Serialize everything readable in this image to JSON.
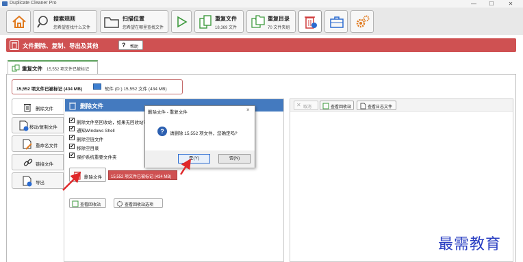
{
  "window": {
    "title": "Duplicate Cleaner Pro",
    "controls": [
      "—",
      "☐",
      "✕"
    ]
  },
  "toolbar": {
    "search_rules_title": "搜索规则",
    "search_rules_sub": "您希望查找什么文件",
    "scan_location_title": "扫描位置",
    "scan_location_sub": "您希望在哪里查找文件",
    "dup_files_title": "重复文件",
    "dup_files_sub": "18,369 文件",
    "dup_folders_title": "重复目录",
    "dup_folders_sub": "70 文件夹组"
  },
  "banner": {
    "title": "文件删除、复制、导出及其他",
    "help_label": "帮助"
  },
  "tab": {
    "title": "重复文件",
    "subtitle": "15,552 项文件已被标记"
  },
  "stats": {
    "marked": "15,552 项文件已被标记 (434 MB)",
    "location": "软件 (D:) 15,552 文件 (434 MB)"
  },
  "side_tabs": [
    {
      "label": "删除文件"
    },
    {
      "label": "移动/复制文件"
    },
    {
      "label": "重命名文件"
    },
    {
      "label": "链接文件"
    },
    {
      "label": "导出"
    }
  ],
  "delete_section": {
    "header": "删除文件",
    "options": [
      "删除文件至回收站，如果无回收站可",
      "通知Windows Shell",
      "删除空链文件",
      "移除空目录",
      "保护系统重要文件夹"
    ],
    "delete_button": "删除文件",
    "marked_badge": "15,552 项文件已被标记 (434 MB)",
    "view_recycle": "查看回收站",
    "recycle_options": "查看回收站选项"
  },
  "right_panel": {
    "cancel_label": "取消",
    "view_recycle": "查看回收站",
    "view_log": "查看日志文件"
  },
  "dialog": {
    "title": "删除文件 - 重复文件",
    "close": "×",
    "icon_text": "?",
    "message": "请删除 15,552 项文件，您确定吗?",
    "yes_label": "是(Y)",
    "no_label": "否(N)"
  },
  "watermark": "最需教育",
  "colors": {
    "banner_red": "#cf5152",
    "section_blue": "#447abf",
    "arrow_red": "#e0282a",
    "watermark_blue": "#2a3fc2"
  }
}
